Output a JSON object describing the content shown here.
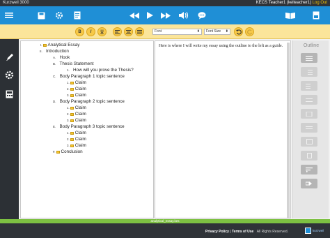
{
  "title_bar": {
    "brand": "Kurzweil 3000",
    "user": "KECS Teacher1 (kelteacher1)",
    "logout": "Log Out"
  },
  "main_toolbar": {
    "icons": [
      "menu-icon",
      "save-icon",
      "settings-icon",
      "document-icon",
      "rewind-icon",
      "play-icon",
      "fast-forward-icon",
      "volume-icon",
      "chat-icon",
      "book-icon",
      "page-icon"
    ]
  },
  "format_bar": {
    "bold": "B",
    "italic": "I",
    "underline": "U",
    "font_value": "Font",
    "font_size_value": "Font Size"
  },
  "outline": {
    "rows": [
      {
        "marker": "I.",
        "text": "Analytical Essay",
        "folder": true
      },
      {
        "marker": "II.",
        "text": "Introduction",
        "folder": false
      },
      {
        "marker": "A.",
        "text": "Hook",
        "folder": false
      },
      {
        "marker": "B.",
        "text": "Thesis Statement",
        "folder": false
      },
      {
        "marker": "1.",
        "text": "How will you prove the Thesis?",
        "folder": false
      },
      {
        "marker": "C.",
        "text": "Body Paragraph 1 topic sentence",
        "folder": false
      },
      {
        "marker": "1.",
        "text": "Claim",
        "folder": true
      },
      {
        "marker": "2.",
        "text": "Claim",
        "folder": true
      },
      {
        "marker": "3.",
        "text": "Claim",
        "folder": true
      },
      {
        "marker": "D.",
        "text": "Body Paragraph 2 topic sentence",
        "folder": false
      },
      {
        "marker": "1.",
        "text": "Claim",
        "folder": true
      },
      {
        "marker": "2.",
        "text": "Claim",
        "folder": true
      },
      {
        "marker": "3.",
        "text": "Claim",
        "folder": true
      },
      {
        "marker": "E.",
        "text": "Body Paragraph 3 topic sentence",
        "folder": false
      },
      {
        "marker": "1.",
        "text": "Claim",
        "folder": true
      },
      {
        "marker": "2.",
        "text": "Claim",
        "folder": true
      },
      {
        "marker": "3.",
        "text": "Claim",
        "folder": true
      },
      {
        "marker": "F.",
        "text": "Conclusion",
        "folder": true
      }
    ]
  },
  "essay": {
    "text": "Here is where I will write my essay using the outline to the left as a guide."
  },
  "outline_panel": {
    "title": "Outline"
  },
  "file_bar": {
    "filename": "analytical_essay.kes"
  },
  "footer": {
    "privacy": "Privacy Policy",
    "separator": "|",
    "terms": "Terms of Use",
    "rights": "All Rights Reserved.",
    "logo_text": "kurzweil"
  },
  "colors": {
    "toolbar_blue": "#1f8fd6",
    "format_yellow": "#fbe59a",
    "file_green": "#7dc142",
    "dark": "#2f3338"
  }
}
